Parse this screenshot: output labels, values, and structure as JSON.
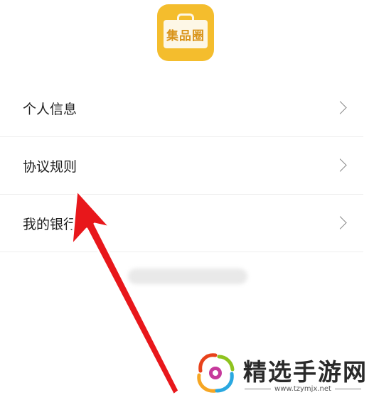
{
  "app": {
    "logo_text": "集品圈",
    "brand_color": "#f4bd2d"
  },
  "menu": {
    "items": [
      {
        "label": "个人信息",
        "icon": "chevron-right-icon"
      },
      {
        "label": "协议规则",
        "icon": "chevron-right-icon"
      },
      {
        "label": "我的银行",
        "icon": "chevron-right-icon"
      }
    ]
  },
  "annotation": {
    "arrow_color": "#e8171b"
  },
  "watermark": {
    "title": "精选手游网",
    "url": "www.tzymjx.net"
  }
}
